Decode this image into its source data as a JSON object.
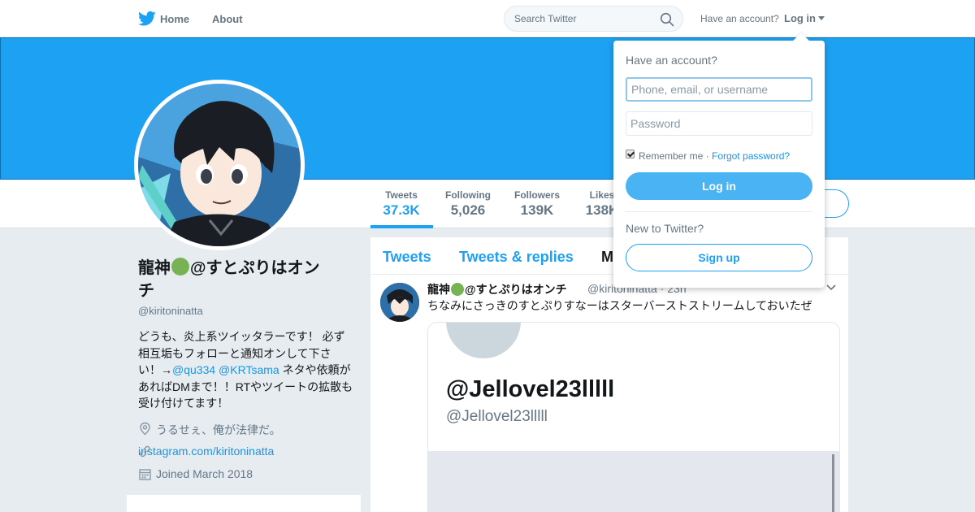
{
  "nav": {
    "home_label": "Home",
    "about_label": "About",
    "search_placeholder": "Search Twitter",
    "have_account": "Have an account?",
    "login_label": "Log in"
  },
  "stats": [
    {
      "label": "Tweets",
      "value": "37.3K"
    },
    {
      "label": "Following",
      "value": "5,026"
    },
    {
      "label": "Followers",
      "value": "139K"
    },
    {
      "label": "Likes",
      "value": "138K"
    }
  ],
  "profile": {
    "name": "龍神🐉@すとぷりはオンチ",
    "name_part1": "龍神",
    "name_part2": "@すとぷりはオン",
    "name_part3": "チ",
    "handle": "@kiritoninatta",
    "bio_before": "どうも、炎上系ツイッタラーです！ 必ず相互垢もフォローと通知オンして下さい！→",
    "bio_link1": "@qu334",
    "bio_link2": "@KRTsama",
    "bio_after": " ネタや依頼があればDMまで！！RTやツイートの拡散も受け付けてます！",
    "location": "うるせぇ、俺が法律だ。",
    "website": "instagram.com/kiritoninatta",
    "joined": "Joined March 2018"
  },
  "timeline": {
    "tabs": [
      "Tweets",
      "Tweets & replies",
      "M"
    ],
    "tweet": {
      "name_part1": "龍神",
      "name_part2": "@すとぷりはオンチ",
      "handle_time": "@kiritoninatta · 23h",
      "text": "ちなみにさっきのすとぷりすなーはスターバーストストリームしておいたぜ",
      "card_title": "@Jellovel23lllll",
      "card_sub": "@Jellovel23lllll"
    }
  },
  "login_dropdown": {
    "title": "Have an account?",
    "username_placeholder": "Phone, email, or username",
    "password_placeholder": "Password",
    "remember_label": "Remember me ·",
    "forgot_label": "Forgot password?",
    "login_button": "Log in",
    "new_label": "New to Twitter?",
    "signup_button": "Sign up"
  },
  "colors": {
    "brand": "#1da1f2",
    "link": "#1b95e0",
    "background": "#e6ecf0"
  }
}
